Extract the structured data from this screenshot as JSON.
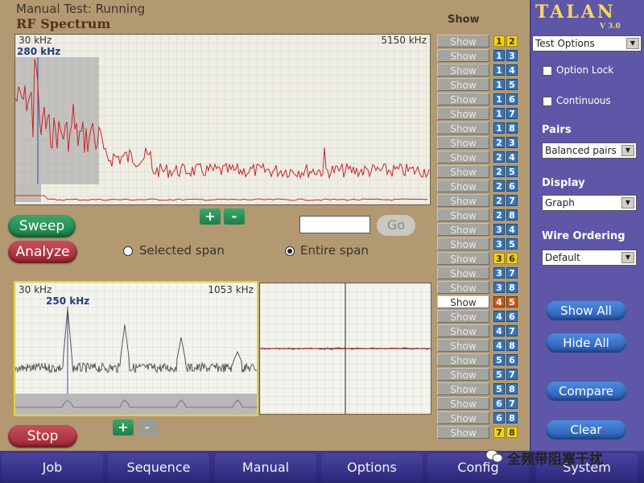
{
  "status": "Manual Test: Running",
  "section_title": "RF Spectrum",
  "top_plot": {
    "start_freq": "30 kHz",
    "marker_freq": "280 kHz",
    "end_freq": "5150 kHz"
  },
  "bottom_plot": {
    "start_freq": "30 kHz",
    "marker_freq": "250 kHz",
    "end_freq": "1053 kHz"
  },
  "buttons": {
    "sweep": "Sweep",
    "analyze": "Analyze",
    "stop": "Stop",
    "zoom_in": "+",
    "zoom_out": "-",
    "go": "Go"
  },
  "span": {
    "selected_label": "Selected span",
    "entire_label": "Entire span",
    "selected": "Entire span"
  },
  "go_input": {
    "value": ""
  },
  "show_column": {
    "header": "Show",
    "rows": [
      {
        "label": "Show",
        "a": "1",
        "b": "2",
        "color": "yellow",
        "active": false
      },
      {
        "label": "Show",
        "a": "1",
        "b": "3",
        "color": "blue",
        "active": false
      },
      {
        "label": "Show",
        "a": "1",
        "b": "4",
        "color": "blue",
        "active": false
      },
      {
        "label": "Show",
        "a": "1",
        "b": "5",
        "color": "blue",
        "active": false
      },
      {
        "label": "Show",
        "a": "1",
        "b": "6",
        "color": "blue",
        "active": false
      },
      {
        "label": "Show",
        "a": "1",
        "b": "7",
        "color": "blue",
        "active": false
      },
      {
        "label": "Show",
        "a": "1",
        "b": "8",
        "color": "blue",
        "active": false
      },
      {
        "label": "Show",
        "a": "2",
        "b": "3",
        "color": "blue",
        "active": false
      },
      {
        "label": "Show",
        "a": "2",
        "b": "4",
        "color": "blue",
        "active": false
      },
      {
        "label": "Show",
        "a": "2",
        "b": "5",
        "color": "blue",
        "active": false
      },
      {
        "label": "Show",
        "a": "2",
        "b": "6",
        "color": "blue",
        "active": false
      },
      {
        "label": "Show",
        "a": "2",
        "b": "7",
        "color": "blue",
        "active": false
      },
      {
        "label": "Show",
        "a": "2",
        "b": "8",
        "color": "blue",
        "active": false
      },
      {
        "label": "Show",
        "a": "3",
        "b": "4",
        "color": "blue",
        "active": false
      },
      {
        "label": "Show",
        "a": "3",
        "b": "5",
        "color": "blue",
        "active": false
      },
      {
        "label": "Show",
        "a": "3",
        "b": "6",
        "color": "yellow",
        "active": false
      },
      {
        "label": "Show",
        "a": "3",
        "b": "7",
        "color": "blue",
        "active": false
      },
      {
        "label": "Show",
        "a": "3",
        "b": "8",
        "color": "blue",
        "active": false
      },
      {
        "label": "Show",
        "a": "4",
        "b": "5",
        "color": "orange",
        "active": true
      },
      {
        "label": "Show",
        "a": "4",
        "b": "6",
        "color": "blue",
        "active": false
      },
      {
        "label": "Show",
        "a": "4",
        "b": "7",
        "color": "blue",
        "active": false
      },
      {
        "label": "Show",
        "a": "4",
        "b": "8",
        "color": "blue",
        "active": false
      },
      {
        "label": "Show",
        "a": "5",
        "b": "6",
        "color": "blue",
        "active": false
      },
      {
        "label": "Show",
        "a": "5",
        "b": "7",
        "color": "blue",
        "active": false
      },
      {
        "label": "Show",
        "a": "5",
        "b": "8",
        "color": "blue",
        "active": false
      },
      {
        "label": "Show",
        "a": "6",
        "b": "7",
        "color": "blue",
        "active": false
      },
      {
        "label": "Show",
        "a": "6",
        "b": "8",
        "color": "blue",
        "active": false
      },
      {
        "label": "Show",
        "a": "7",
        "b": "8",
        "color": "yellow",
        "active": false
      }
    ]
  },
  "right_panel": {
    "logo": "TALAN",
    "version": "V 3.0",
    "test_options": "Test Options",
    "option_lock": "Option Lock",
    "continuous": "Continuous",
    "pairs_label": "Pairs",
    "pairs_value": "Balanced pairs",
    "display_label": "Display",
    "display_value": "Graph",
    "wire_label": "Wire Ordering",
    "wire_value": "Default",
    "show_all": "Show All",
    "hide_all": "Hide All",
    "compare": "Compare",
    "clear": "Clear"
  },
  "nav": [
    "Job",
    "Sequence",
    "Manual",
    "Options",
    "Config",
    "System"
  ],
  "watermark": "全频带阻塞干扰",
  "colors": {
    "accent": "#5e56a6",
    "trace_red": "#c8242b",
    "trace_grey": "#555555",
    "background": "#b29972"
  }
}
